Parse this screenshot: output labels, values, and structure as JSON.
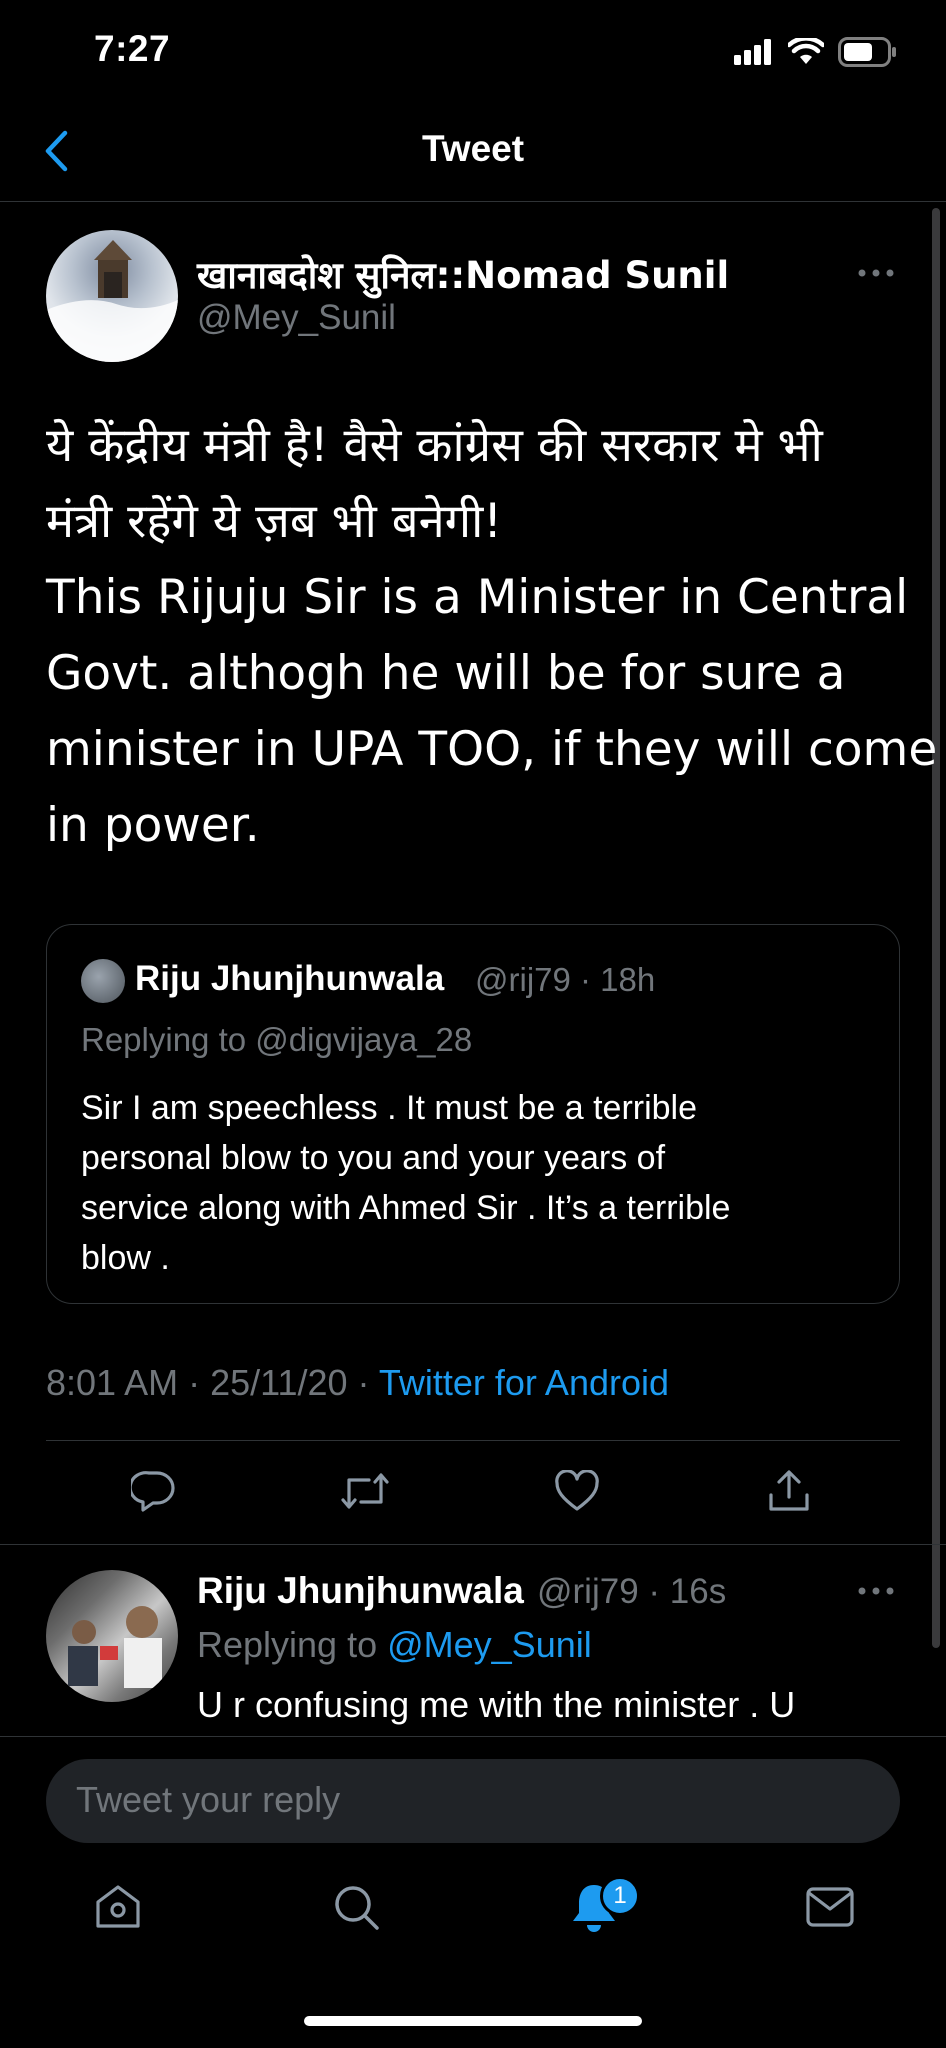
{
  "status_bar": {
    "time": "7:27"
  },
  "header": {
    "title": "Tweet"
  },
  "main_tweet": {
    "author_name": "खानाबदोश सुनिल::Nomad Sunil",
    "author_handle": "@Mey_Sunil",
    "text_lines": [
      "ये केंद्रीय मंत्री है! वैसे कांग्रेस की सरकार मे भी",
      "मंत्री रहेंगे ये ज़ब भी बनेगी!",
      "This Rijuju Sir is a Minister in Central",
      "Govt. althogh he will be for sure a",
      "minister in UPA TOO, if they will come",
      "in power."
    ],
    "timestamp": "8:01 AM · 25/11/20 · ",
    "source": "Twitter for Android"
  },
  "quoted_tweet": {
    "author_name": "Riju Jhunjhunwala",
    "meta": "@rij79 · 18h",
    "replying_to": "Replying to @digvijaya_28",
    "text_lines": [
      "Sir I am speechless . It must be a terrible",
      "personal blow to you and your years of",
      "service along with Ahmed Sir . It’s a terrible",
      "blow ."
    ]
  },
  "reply_tweet": {
    "author_name": "Riju Jhunjhunwala",
    "meta": "@rij79 · 16s",
    "replying_prefix": "Replying to ",
    "replying_mention": "@Mey_Sunil",
    "text": "U r confusing me with the minister . U"
  },
  "composer": {
    "placeholder": "Tweet your reply"
  },
  "tabbar": {
    "notifications_badge": "1"
  },
  "colors": {
    "accent": "#1d9bf0",
    "background": "#000000",
    "muted": "#71767b"
  }
}
